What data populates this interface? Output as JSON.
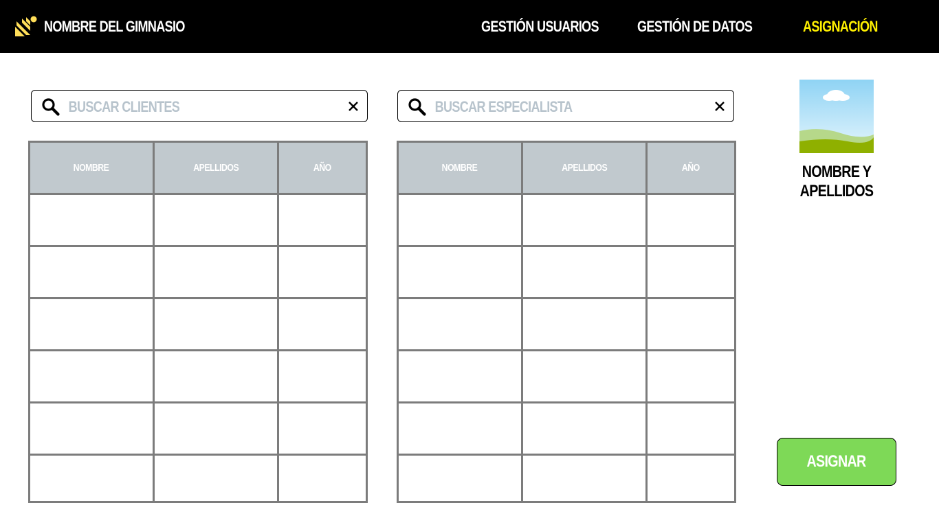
{
  "header": {
    "brand": "NOMBRE DEL GIMNASIO",
    "nav": [
      {
        "label": "GESTIÓN USUARIOS"
      },
      {
        "label": "GESTIÓN DE DATOS"
      },
      {
        "label": "ASIGNACIÓN",
        "active": true
      }
    ],
    "colors": {
      "background": "#000000",
      "active": "#fff000",
      "logo": "#ffde59"
    }
  },
  "clients": {
    "search_placeholder": "BUSCAR CLIENTES",
    "columns": [
      "NOMBRE",
      "APELLIDOS",
      "AÑO"
    ],
    "rows": [
      [
        "",
        "",
        ""
      ],
      [
        "",
        "",
        ""
      ],
      [
        "",
        "",
        ""
      ],
      [
        "",
        "",
        ""
      ],
      [
        "",
        "",
        ""
      ],
      [
        "",
        "",
        ""
      ]
    ]
  },
  "specialists": {
    "search_placeholder": "BUSCAR ESPECIALISTA",
    "columns": [
      "NOMBRE",
      "APELLIDOS",
      "AÑO"
    ],
    "rows": [
      [
        "",
        "",
        ""
      ],
      [
        "",
        "",
        ""
      ],
      [
        "",
        "",
        ""
      ],
      [
        "",
        "",
        ""
      ],
      [
        "",
        "",
        ""
      ],
      [
        "",
        "",
        ""
      ]
    ]
  },
  "profile": {
    "name": "NOMBRE Y APELLIDOS",
    "image_icon": "image-placeholder-icon"
  },
  "actions": {
    "assign_label": "ASIGNAR",
    "assign_color": "#7ed957"
  },
  "icons": {
    "search": "search-icon",
    "clear": "close-icon",
    "logo": "logo-icon"
  }
}
